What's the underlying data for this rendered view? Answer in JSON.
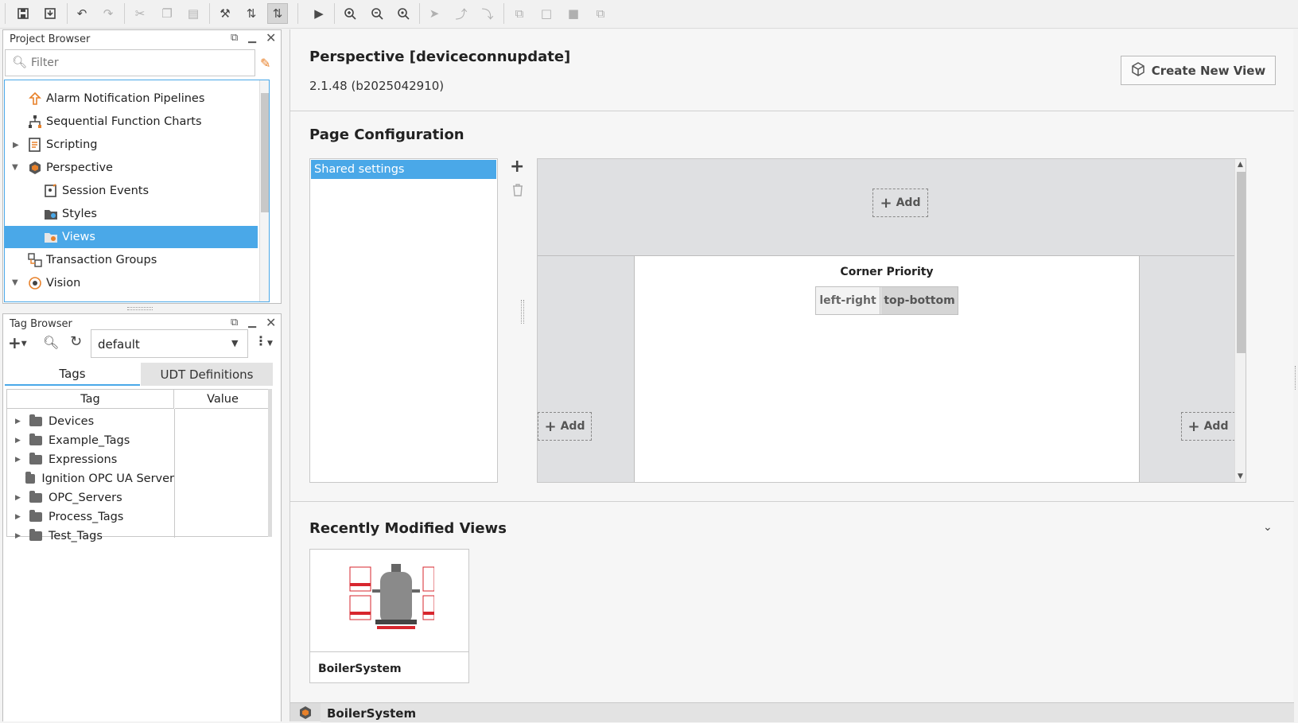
{
  "toolbar": {
    "icons": [
      "save-icon",
      "save-all-icon",
      "undo-icon",
      "redo-icon",
      "cut-icon",
      "copy-icon",
      "paste-icon",
      "component-icon",
      "preview-left-icon",
      "preview-right-icon",
      "play-icon",
      "zoom-in-icon",
      "zoom-out-icon",
      "zoom-fit-icon",
      "pointer-icon",
      "connect-icon",
      "connect-alt-icon",
      "group-icon",
      "ungroup-icon",
      "front-icon",
      "back-icon"
    ]
  },
  "project_browser": {
    "title": "Project Browser",
    "filter_placeholder": "Filter",
    "items": [
      {
        "label": "Alarm Notification Pipelines",
        "icon": "pipeline-icon"
      },
      {
        "label": "Sequential Function Charts",
        "icon": "sfc-icon"
      },
      {
        "label": "Scripting",
        "icon": "scripting-icon"
      },
      {
        "label": "Perspective",
        "icon": "perspective-icon"
      },
      {
        "label": "Session Events",
        "icon": "session-events-icon"
      },
      {
        "label": "Styles",
        "icon": "styles-icon"
      },
      {
        "label": "Views",
        "icon": "views-icon"
      },
      {
        "label": "Transaction Groups",
        "icon": "transaction-groups-icon"
      },
      {
        "label": "Vision",
        "icon": "vision-icon"
      }
    ]
  },
  "tag_browser": {
    "title": "Tag Browser",
    "provider": "default",
    "tabs": [
      "Tags",
      "UDT Definitions"
    ],
    "columns": [
      "Tag",
      "Value"
    ],
    "tags": [
      "Devices",
      "Example_Tags",
      "Expressions",
      "Ignition OPC UA Server",
      "OPC_Servers",
      "Process_Tags",
      "Test_Tags"
    ]
  },
  "main": {
    "project_title": "Perspective [deviceconnupdate]",
    "version": "2.1.48 (b2025042910)",
    "create_view_label": "Create New View",
    "page_config_title": "Page Configuration",
    "shared_settings": "Shared settings",
    "add_label": "Add",
    "corner_priority_label": "Corner Priority",
    "corner_left_right": "left-right",
    "corner_top_bottom": "top-bottom",
    "recent_title": "Recently Modified Views",
    "recent_view_name": "BoilerSystem",
    "bottom_tab_label": "BoilerSystem"
  },
  "colors": {
    "selection": "#4aa8e8",
    "accent_orange": "#e8812a",
    "red": "#d7262e"
  }
}
